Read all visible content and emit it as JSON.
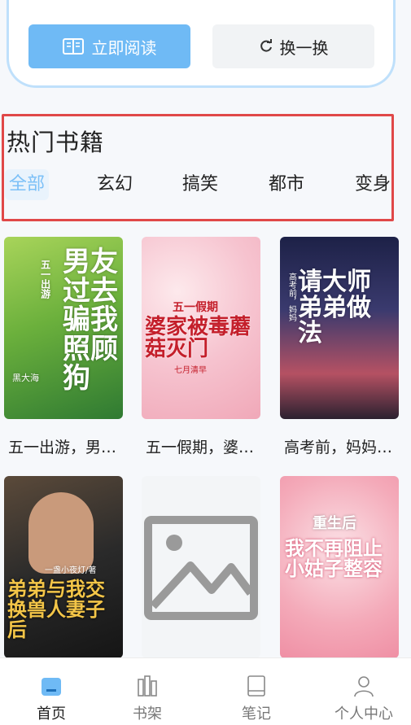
{
  "top_card": {
    "read_button": {
      "label": "立即阅读",
      "icon": "book-open-icon"
    },
    "change_button": {
      "label": "换一换",
      "icon": "refresh-icon"
    }
  },
  "section": {
    "title": "热门书籍",
    "tabs": [
      {
        "label": "全部",
        "active": true
      },
      {
        "label": "玄幻",
        "active": false
      },
      {
        "label": "搞笑",
        "active": false
      },
      {
        "label": "都市",
        "active": false
      },
      {
        "label": "变身",
        "active": false
      }
    ]
  },
  "books": [
    {
      "name": "五一出游，男…",
      "cover_title": "男友过去骗我照顾狗",
      "cover_small": "五一出游",
      "cover_author": "黑大海",
      "colors": [
        "#8ec44a",
        "#2f7a32"
      ]
    },
    {
      "name": "五一假期，婆…",
      "cover_title": "婆家被毒蘑菇灭门",
      "cover_small": "五一假期",
      "cover_author": "七月清早",
      "colors": [
        "#f7c9d4",
        "#fbe7ea"
      ]
    },
    {
      "name": "高考前，妈妈…",
      "cover_title": "请大师弟弟做法",
      "cover_small": "高考前，妈妈",
      "cover_author": "",
      "colors": [
        "#2b2f57",
        "#c9585d"
      ]
    },
    {
      "name": "",
      "cover_title": "弟弟与我交换兽人妻子后",
      "cover_small": "一盏小夜灯/著",
      "cover_author": "",
      "colors": [
        "#3a3a3a",
        "#d6a13b"
      ]
    },
    {
      "name": "",
      "cover_title": "",
      "cover_small": "",
      "cover_author": "",
      "colors": [
        "#f3f5f7",
        "#f3f5f7"
      ],
      "placeholder": true
    },
    {
      "name": "",
      "cover_title": "我不再阻止小姑子整容",
      "cover_small": "重生后",
      "cover_author": "",
      "colors": [
        "#f4a3b2",
        "#f9d1d8"
      ]
    }
  ],
  "bottom_nav": [
    {
      "label": "首页",
      "icon": "home-icon",
      "active": true
    },
    {
      "label": "书架",
      "icon": "bookshelf-icon",
      "active": false
    },
    {
      "label": "笔记",
      "icon": "notes-icon",
      "active": false
    },
    {
      "label": "个人中心",
      "icon": "user-icon",
      "active": false
    }
  ],
  "colors": {
    "accent": "#6fbaf5",
    "highlight_border": "#e04848"
  }
}
